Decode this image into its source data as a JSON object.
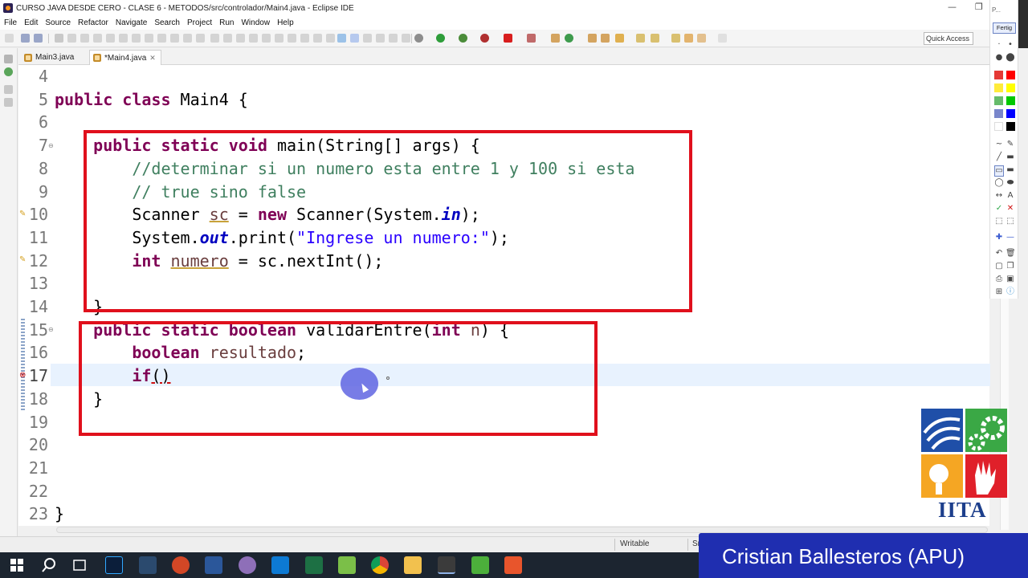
{
  "window": {
    "title": "CURSO JAVA  DESDE CERO - CLASE 6 - METODOS/src/controlador/Main4.java - Eclipse IDE",
    "controls": [
      "—",
      "❐"
    ]
  },
  "menu": [
    "File",
    "Edit",
    "Source",
    "Refactor",
    "Navigate",
    "Search",
    "Project",
    "Run",
    "Window",
    "Help"
  ],
  "toolbar": {
    "quick_access_label": "Quick Access"
  },
  "tabs": [
    {
      "label": "Main3.java",
      "active": false
    },
    {
      "label": "*Main4.java",
      "active": true,
      "close": "✕"
    }
  ],
  "editor": {
    "line_numbers": [
      "4",
      "5",
      "6",
      "7",
      "8",
      "9",
      "10",
      "11",
      "12",
      "13",
      "14",
      "15",
      "16",
      "17",
      "18",
      "19",
      "20",
      "21",
      "22",
      "23"
    ],
    "lines": {
      "l5": {
        "kw1": "public",
        "kw2": "class",
        "rest": " Main4 {"
      },
      "l7": {
        "kw1": "public",
        "kw2": "static",
        "kw3": "void",
        "rest": " main(String[] args) {"
      },
      "l8": {
        "comment": "//determinar si un numero esta entre 1 y 100 si esta"
      },
      "l9": {
        "comment": "// true sino false"
      },
      "l10": {
        "a": "Scanner ",
        "var": "sc",
        "b": " = ",
        "kw": "new",
        "c": " Scanner(System.",
        "field": "in",
        "d": ");"
      },
      "l11": {
        "a": "System.",
        "field": "out",
        "b": ".print(",
        "str": "\"Ingrese un numero:\"",
        "c": ");"
      },
      "l12": {
        "kw": "int",
        "var": "numero",
        "rest": " = sc.nextInt();"
      },
      "l14": {
        "text": "}"
      },
      "l15": {
        "kw1": "public",
        "kw2": "static",
        "kw3": "boolean",
        "mid": " validarEntre(",
        "kw4": "int",
        "param": "n",
        "rest": ") {"
      },
      "l16": {
        "kw": "boolean",
        "var": "resultado",
        "rest": ";"
      },
      "l17": {
        "kw": "if",
        "rest": "()"
      },
      "l18": {
        "text": "}"
      },
      "l23": {
        "text": "}"
      }
    }
  },
  "status": {
    "mode": "Writable",
    "insert": "Sm"
  },
  "palette": {
    "top_label": "P...",
    "button_label": "Fertig",
    "colors": [
      "#e53935",
      "#ff0000",
      "#ffeb3b",
      "#ffff00",
      "#66bb6a",
      "#00c800",
      "#7986cb",
      "#0000ff",
      "#ffffff",
      "#000000"
    ]
  },
  "logo": {
    "text": "IITA"
  },
  "presenter": {
    "name": "Cristian Ballesteros (APU)"
  },
  "taskbar_apps": [
    "windows-start",
    "search",
    "task-view",
    "photoshop",
    "snipping",
    "powerpoint",
    "word",
    "paint",
    "vscode",
    "excel",
    "notepad++",
    "chrome",
    "explorer",
    "eclipse",
    "camtasia-green",
    "camtasia-red"
  ]
}
